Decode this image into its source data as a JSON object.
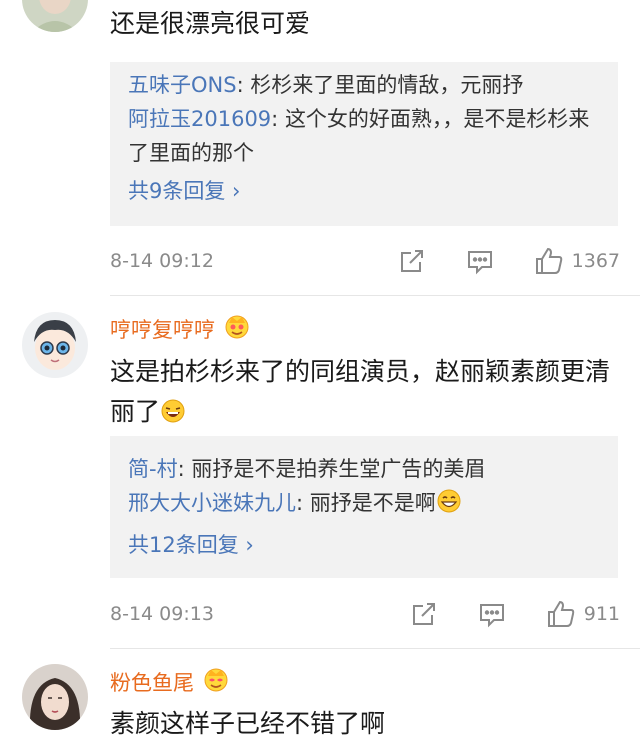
{
  "comments": [
    {
      "text": "还是很漂亮很可爱",
      "replies": [
        {
          "user": "五味子ONS",
          "sep": ": ",
          "text": "杉杉来了里面的情敌，元丽抒"
        },
        {
          "user": "阿拉玉201609",
          "sep": ": ",
          "text": "这个女的好面熟，，是不是杉杉来了里面的那个"
        }
      ],
      "more_replies": "共9条回复 ›",
      "timestamp": "8-14 09:12",
      "likes": "1367"
    },
    {
      "username": "哼哼复哼哼",
      "text": "这是拍杉杉来了的同组演员，赵丽颖素颜更清丽了",
      "replies": [
        {
          "user": "简-村",
          "sep": ": ",
          "text": "丽抒是不是拍养生堂广告的美眉"
        },
        {
          "user": "邢大大小迷妹九儿",
          "sep": ": ",
          "text": "丽抒是不是啊"
        }
      ],
      "more_replies": "共12条回复 ›",
      "timestamp": "8-14 09:13",
      "likes": "911"
    },
    {
      "username": "粉色鱼尾",
      "text": "素颜这样子已经不错了啊"
    }
  ],
  "icons": {
    "share": "share-icon",
    "comment": "comment-icon",
    "like": "thumbs-up-icon",
    "badge": "crown-badge-icon"
  },
  "colors": {
    "username": "#e86b1f",
    "reply_user": "#4a76b8",
    "reply_bg": "#f2f2f2",
    "meta": "#8a8a8a"
  }
}
